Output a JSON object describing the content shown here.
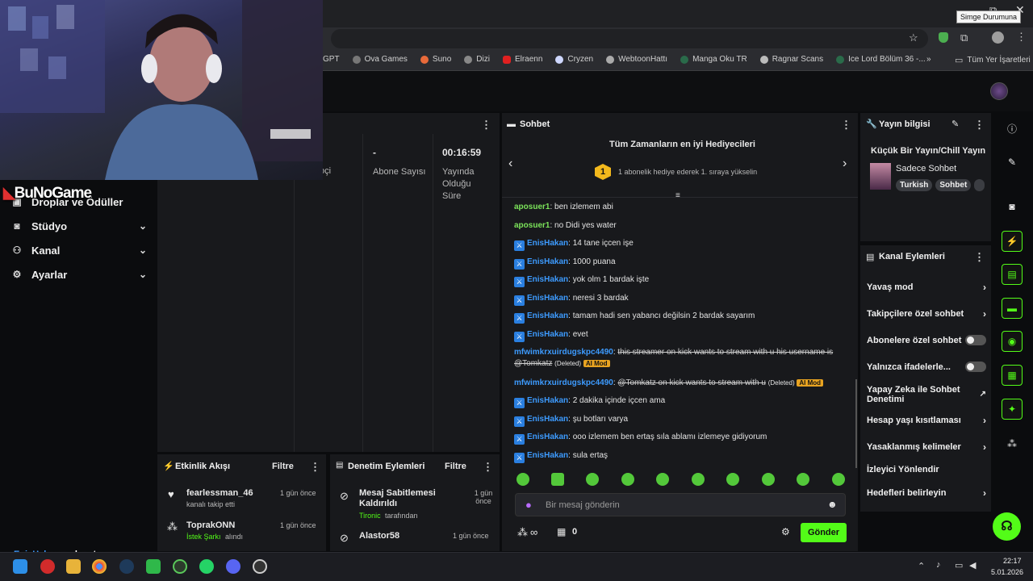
{
  "browser": {
    "tooltip": "Simge Durumuna",
    "bookmarks": [
      "GPT",
      "Ova Games",
      "Suno",
      "Dizi",
      "Elraenn",
      "Cryzen",
      "WebtoonHattı",
      "Manga Oku TR",
      "Ragnar Scans",
      "Ice Lord Bölüm 36 -..."
    ],
    "bookmarks_more": "»",
    "all_bookmarks": "Tüm Yer İşaretleri"
  },
  "overlay": {
    "streamer_logo": "BuNoGame"
  },
  "sidebar": {
    "items": [
      {
        "label": "Droplar ve Ödüller",
        "icon": "gift-icon"
      },
      {
        "label": "Stüdyo",
        "icon": "studio-icon"
      },
      {
        "label": "Kanal",
        "icon": "channel-icon"
      },
      {
        "label": "Ayarlar",
        "icon": "gear-icon"
      }
    ]
  },
  "stats": {
    "partial_label": "oçi",
    "subscribers_value": "-",
    "subscribers_label": "Abone Sayısı",
    "live_time_value": "00:16:59",
    "live_time_label": "Yayında Olduğu Süre"
  },
  "activity": {
    "title": "Etkinlik Akışı",
    "filter": "Filtre",
    "items": [
      {
        "user": "fearlessman_46",
        "desc": "kanalı takip etti",
        "time": "1 gün önce"
      },
      {
        "user": "ToprakONN",
        "desc_highlight": "İstek Şarkı",
        "desc": "alındı",
        "time": "1 gün önce"
      }
    ]
  },
  "moderation": {
    "title": "Denetim Eylemleri",
    "filter": "Filtre",
    "items": [
      {
        "title": "Mesaj Sabitlemesi Kaldırıldı",
        "by_user": "Tironic",
        "by_text": "tarafından",
        "time": "1 gün önce"
      },
      {
        "title": "Alastor58",
        "time": "1 gün önce"
      }
    ]
  },
  "chat": {
    "title": "Sohbet",
    "leaderboard_title": "Tüm Zamanların en iyi Hediyecileri",
    "leaderboard_rank": "1",
    "leaderboard_text": "1 abonelik hediye ederek 1. sıraya yükselin",
    "messages": [
      {
        "user": "aposuer1",
        "text": "ben izlemem abi",
        "color": "green"
      },
      {
        "user": "aposuer1",
        "text": "no Didi yes water",
        "color": "green"
      },
      {
        "user": "EnisHakan",
        "text": "14 tane içcen işe",
        "color": "blue",
        "badge": true
      },
      {
        "user": "EnisHakan",
        "text": "1000 puana",
        "color": "blue",
        "badge": true
      },
      {
        "user": "EnisHakan",
        "text": "yok olm 1 bardak işte",
        "color": "blue",
        "badge": true
      },
      {
        "user": "EnisHakan",
        "text": "neresi 3 bardak",
        "color": "blue",
        "badge": true
      },
      {
        "user": "EnisHakan",
        "text": "tamam hadi sen yabancı değilsin 2 bardak sayarım",
        "color": "blue",
        "badge": true
      },
      {
        "user": "EnisHakan",
        "text": "evet",
        "color": "blue",
        "badge": true
      }
    ],
    "deleted_1_user": "mfwimkrxuirdugskpc4490",
    "deleted_1_text": "this streamer on kick wants to stream with u his username is @Tomkatz",
    "deleted_2_user": "mfwimkrxuirdugskpc4490",
    "deleted_2_text": "@Tomkatz on kick wants to stream with u",
    "deleted_tag": "(Deleted)",
    "ai_mod": "AI Mod",
    "messages2": [
      {
        "user": "EnisHakan",
        "text": "2 dakika içinde içcen ama"
      },
      {
        "user": "EnisHakan",
        "text": "şu botları varya"
      },
      {
        "user": "EnisHakan",
        "text": "ooo izlemem ben ertaş sıla ablamı izlemeye gidiyorum"
      },
      {
        "user": "EnisHakan",
        "text": "sula ertaş"
      }
    ],
    "input_placeholder": "Bir mesaj gönderin",
    "points_icon": "∞",
    "gift_count": "0",
    "send": "Gönder"
  },
  "stream_info": {
    "title": "Yayın bilgisi",
    "stream_title": "Küçük Bir Yayın/Chill Yayın",
    "category": "Sadece Sohbet",
    "tags": [
      "Turkish",
      "Sohbet"
    ]
  },
  "channel_actions": {
    "title": "Kanal Eylemleri",
    "items": [
      {
        "label": "Yavaş mod",
        "type": "chevron"
      },
      {
        "label": "Takipçilere özel sohbet",
        "type": "chevron"
      },
      {
        "label": "Abonelere özel sohbet",
        "type": "toggle"
      },
      {
        "label": "Yalnızca ifadelerle...",
        "type": "toggle"
      },
      {
        "label": "Yapay Zeka ile Sohbet Denetimi",
        "type": "external"
      },
      {
        "label": "Hesap yaşı kısıtlaması",
        "type": "chevron"
      },
      {
        "label": "Yasaklanmış kelimeler",
        "type": "chevron"
      },
      {
        "label": "İzleyici Yönlendir",
        "type": "none"
      },
      {
        "label": "Hedefleri belirleyin",
        "type": "chevron"
      }
    ]
  },
  "caption": {
    "user": "EnisHakan:",
    "text": "sula ertaş"
  },
  "taskbar": {
    "time": "22:17",
    "date": "5.01.2026"
  },
  "colors": {
    "kick_green": "#53fc18",
    "username_blue": "#3d9bff",
    "username_green": "#7be35a",
    "panel_bg": "#18191c"
  }
}
